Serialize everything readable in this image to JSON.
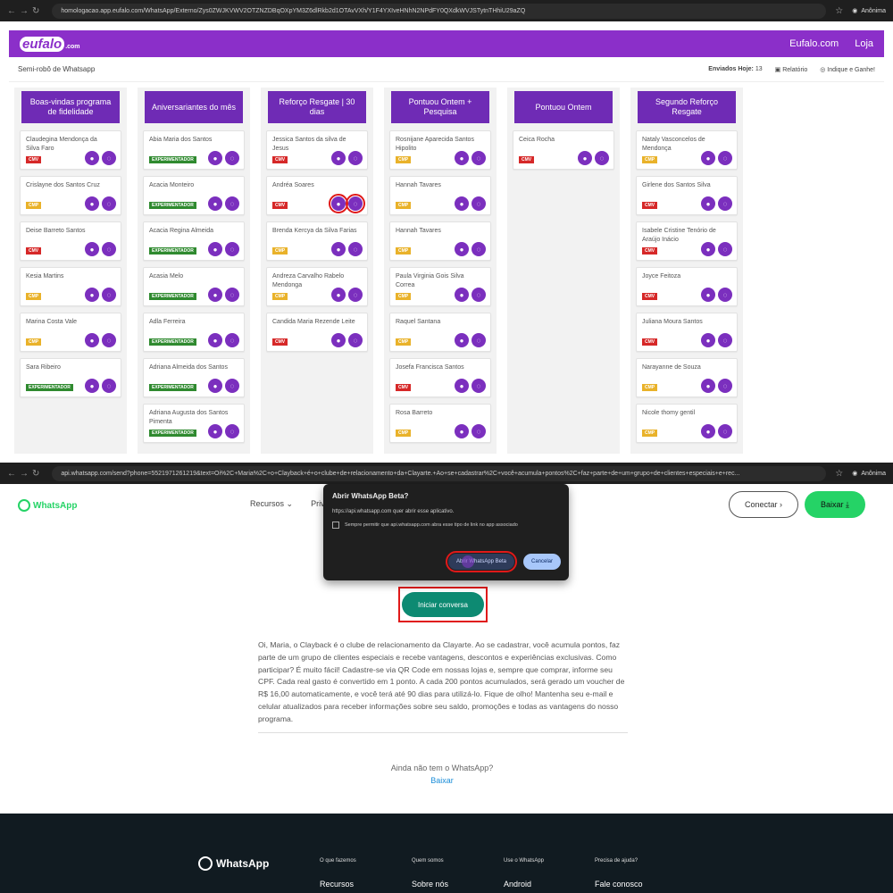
{
  "top_browser": {
    "url": "homologacao.app.eufalo.com/WhatsApp/Externo/Zys0ZWJKVWV2OTZNZDBqOXpYM3Z6dlRkb2d1OTAvVXh/Y1F4YXIveHNhN2NPdFY0QXdkWVJSTytnTHhiU29aZQ",
    "anon_label": "Anônima"
  },
  "app": {
    "logo_main": "eufalo",
    "logo_suffix": ".com",
    "nav": [
      "Eufalo.com",
      "Loja"
    ],
    "subtitle": "Semi-robô de Whatsapp",
    "sent_label": "Enviados Hoje:",
    "sent_count": "13",
    "report_label": "Relatório",
    "refer_label": "Indique e Ganhe!"
  },
  "columns": [
    {
      "title": "Boas-vindas programa de fidelidade",
      "cards": [
        {
          "name": "Claudegina Mendonça da Silva Faro",
          "tag": "CMV",
          "tag_class": "cmv"
        },
        {
          "name": "Crislayne dos Santos Cruz",
          "tag": "CMP",
          "tag_class": "cmp"
        },
        {
          "name": "Deise Barreto Santos",
          "tag": "CMV",
          "tag_class": "cmv"
        },
        {
          "name": "Kesia Martins",
          "tag": "CMP",
          "tag_class": "cmp"
        },
        {
          "name": "Marina Costa Vale",
          "tag": "CMP",
          "tag_class": "cmp"
        },
        {
          "name": "Sara Ribeiro",
          "tag": "EXPERIMENTADOR",
          "tag_class": "exp"
        }
      ]
    },
    {
      "title": "Aniversariantes do mês",
      "cards": [
        {
          "name": "Abia Maria dos Santos",
          "tag": "EXPERIMENTADOR",
          "tag_class": "exp"
        },
        {
          "name": "Acacia Monteiro",
          "tag": "EXPERIMENTADOR",
          "tag_class": "exp"
        },
        {
          "name": "Acacia Regina Almeida",
          "tag": "EXPERIMENTADOR",
          "tag_class": "exp"
        },
        {
          "name": "Acasia Melo",
          "tag": "EXPERIMENTADOR",
          "tag_class": "exp"
        },
        {
          "name": "Adla Ferreira",
          "tag": "EXPERIMENTADOR",
          "tag_class": "exp"
        },
        {
          "name": "Adriana Almeida dos Santos",
          "tag": "EXPERIMENTADOR",
          "tag_class": "exp"
        },
        {
          "name": "Adriana Augusta dos Santos Pimenta",
          "tag": "EXPERIMENTADOR",
          "tag_class": "exp"
        }
      ]
    },
    {
      "title": "Reforço Resgate | 30 dias",
      "cards": [
        {
          "name": "Jessica Santos da silva de Jesus",
          "tag": "CMV",
          "tag_class": "cmv"
        },
        {
          "name": "Andréa Soares",
          "tag": "CMV",
          "tag_class": "cmv",
          "highlight": true
        },
        {
          "name": "Brenda Kercya da Silva Farias",
          "tag": "CMP",
          "tag_class": "cmp"
        },
        {
          "name": "Andreza Carvalho Rabelo Mendonga",
          "tag": "CMP",
          "tag_class": "cmp"
        },
        {
          "name": "Candida Maria Rezende Leite",
          "tag": "CMV",
          "tag_class": "cmv"
        }
      ]
    },
    {
      "title": "Pontuou Ontem + Pesquisa",
      "cards": [
        {
          "name": "Rosnijane Aparecida Santos Hipolito",
          "tag": "CMP",
          "tag_class": "cmp"
        },
        {
          "name": "Hannah Tavares",
          "tag": "CMP",
          "tag_class": "cmp"
        },
        {
          "name": "Hannah Tavares",
          "tag": "CMP",
          "tag_class": "cmp"
        },
        {
          "name": "Paula Virginia Gois Silva Correa",
          "tag": "CMP",
          "tag_class": "cmp"
        },
        {
          "name": "Raquel Santana",
          "tag": "CMP",
          "tag_class": "cmp"
        },
        {
          "name": "Josefa Francisca Santos",
          "tag": "CMV",
          "tag_class": "cmv"
        },
        {
          "name": "Rosa Barreto",
          "tag": "CMP",
          "tag_class": "cmp"
        }
      ]
    },
    {
      "title": "Pontuou Ontem",
      "cards": [
        {
          "name": "Ceica Rocha",
          "tag": "CMV",
          "tag_class": "cmv"
        }
      ]
    },
    {
      "title": "Segundo Reforço Resgate",
      "cards": [
        {
          "name": "Nataly Vasconcelos de Mendonça",
          "tag": "CMP",
          "tag_class": "cmp"
        },
        {
          "name": "Girlene dos Santos Silva",
          "tag": "CMV",
          "tag_class": "cmv"
        },
        {
          "name": "Isabele Cristine Tenório de Araújo Inácio",
          "tag": "CMV",
          "tag_class": "cmv"
        },
        {
          "name": "Joyce Feitoza",
          "tag": "CMV",
          "tag_class": "cmv"
        },
        {
          "name": "Juliana Moura Santos",
          "tag": "CMV",
          "tag_class": "cmv"
        },
        {
          "name": "Narayanne de Souza",
          "tag": "CMP",
          "tag_class": "cmp"
        },
        {
          "name": "Nicole thomy gentil",
          "tag": "CMP",
          "tag_class": "cmp"
        }
      ]
    }
  ],
  "bottom_browser": {
    "url": "api.whatsapp.com/send?phone=5521971261219&text=Oi%2C+Maria%2C+o+Clayback+é+o+clube+de+relacionamento+da+Clayarte.+Ao+se+cadastrar%2C+você+acumula+pontos%2C+faz+parte+de+um+grupo+de+clientes+especiais+e+rec...",
    "anon_label": "Anônima"
  },
  "wa": {
    "logo": "WhatsApp",
    "menu": [
      "Recursos ⌄",
      "Priva"
    ],
    "connect": "Conectar  ›",
    "download": "Baixar  ⤓",
    "start_chat": "Iniciar conversa",
    "message": "Oi, Maria, o Clayback é o clube de relacionamento da Clayarte. Ao se cadastrar, você acumula pontos, faz parte de um grupo de clientes especiais e recebe vantagens, descontos e experiências exclusivas. Como participar? É muito fácil! Cadastre-se via QR Code em nossas lojas e, sempre que comprar, informe seu CPF. Cada real gasto é convertido em 1 ponto. A cada 200 pontos acumulados, será gerado um voucher de R$ 16,00 automaticamente, e você terá até 90 dias para utilizá-lo. Fique de olho! Mantenha seu e-mail e celular atualizados para receber informações sobre seu saldo, promoções e todas as vantagens do nosso programa.",
    "no_app": "Ainda não tem o WhatsApp?",
    "download_link": "Baixar"
  },
  "dialog": {
    "title": "Abrir WhatsApp Beta?",
    "desc": "https://api.whatsapp.com quer abrir esse aplicativo.",
    "checkbox": "Sempre permitir que api.whatsapp.com abra esse tipo de link no app associado",
    "open_btn": "Abrir WhatsApp Beta",
    "cancel_btn": "Cancelar"
  },
  "footer": {
    "logo": "WhatsApp",
    "cols": [
      {
        "head": "O que fazemos",
        "item": "Recursos"
      },
      {
        "head": "Quem somos",
        "item": "Sobre nós"
      },
      {
        "head": "Use o WhatsApp",
        "item": "Android"
      },
      {
        "head": "Precisa de ajuda?",
        "item": "Fale conosco"
      }
    ]
  }
}
